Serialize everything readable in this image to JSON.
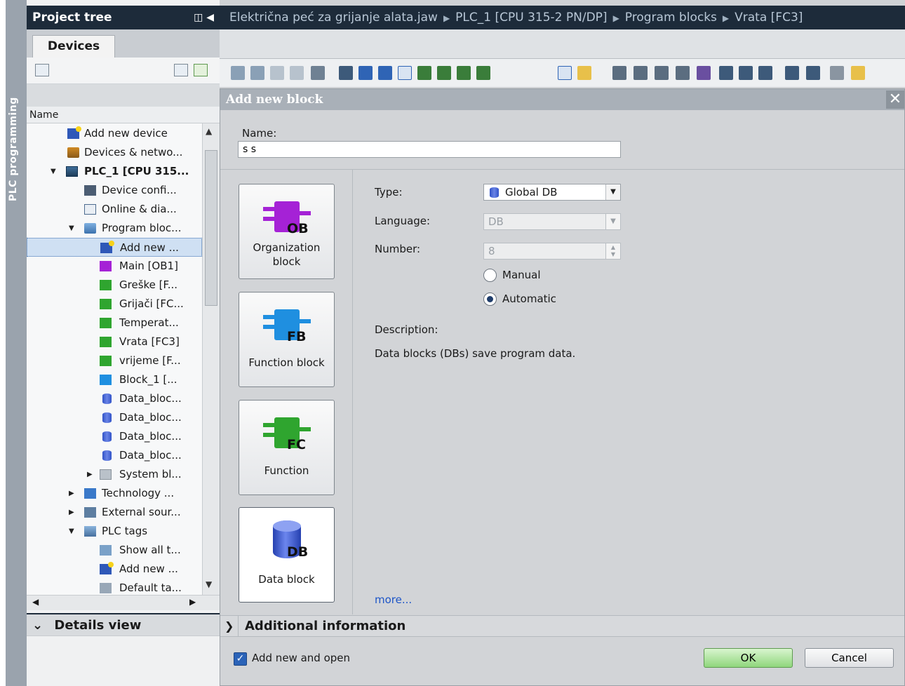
{
  "sidebar_strip": {
    "label": "PLC programming"
  },
  "project_tree": {
    "title": "Project tree",
    "tab": "Devices",
    "column_header": "Name",
    "items": [
      {
        "label": "Add new device",
        "icon": "add-device-icon",
        "level": 1
      },
      {
        "label": "Devices & netwo...",
        "icon": "network-icon",
        "level": 1
      },
      {
        "label": "PLC_1 [CPU 315...",
        "icon": "plc-icon",
        "level": 1,
        "expanded": true
      },
      {
        "label": "Device confi...",
        "icon": "device-config-icon",
        "level": 2
      },
      {
        "label": "Online & dia...",
        "icon": "online-diag-icon",
        "level": 2
      },
      {
        "label": "Program bloc...",
        "icon": "folder-icon",
        "level": 2,
        "expanded": true
      },
      {
        "label": "Add new ...",
        "icon": "add-block-icon",
        "level": 3,
        "selected": true
      },
      {
        "label": "Main [OB1]",
        "icon": "ob-icon",
        "level": 3
      },
      {
        "label": "Greške [F...",
        "icon": "fc-icon",
        "level": 3
      },
      {
        "label": "Grijači [FC...",
        "icon": "fc-icon",
        "level": 3
      },
      {
        "label": "Temperat...",
        "icon": "fc-icon",
        "level": 3
      },
      {
        "label": "Vrata [FC3]",
        "icon": "fc-icon",
        "level": 3
      },
      {
        "label": "vrijeme [F...",
        "icon": "fc-icon",
        "level": 3
      },
      {
        "label": "Block_1 [...",
        "icon": "fb-icon",
        "level": 3
      },
      {
        "label": "Data_bloc...",
        "icon": "db-icon",
        "level": 3
      },
      {
        "label": "Data_bloc...",
        "icon": "db-icon",
        "level": 3
      },
      {
        "label": "Data_bloc...",
        "icon": "db-icon",
        "level": 3
      },
      {
        "label": "Data_bloc...",
        "icon": "db-icon",
        "level": 3
      },
      {
        "label": "System bl...",
        "icon": "system-blocks-icon",
        "level": 3,
        "collapsed": true
      },
      {
        "label": "Technology ...",
        "icon": "technology-icon",
        "level": 2,
        "collapsed": true
      },
      {
        "label": "External sour...",
        "icon": "external-source-icon",
        "level": 2,
        "collapsed": true
      },
      {
        "label": "PLC tags",
        "icon": "plc-tags-icon",
        "level": 2,
        "expanded": true
      },
      {
        "label": "Show all t...",
        "icon": "show-tags-icon",
        "level": 3
      },
      {
        "label": "Add new ...",
        "icon": "add-tag-table-icon",
        "level": 3
      },
      {
        "label": "Default ta...",
        "icon": "default-table-icon",
        "level": 3
      }
    ],
    "details_view": "Details view"
  },
  "breadcrumb": {
    "parts": [
      "Električna peć za grijanje alata.jaw",
      "PLC_1 [CPU 315-2 PN/DP]",
      "Program blocks",
      "Vrata [FC3]"
    ]
  },
  "dialog": {
    "title": "Add new block",
    "name_label": "Name:",
    "name_value": "s s",
    "blocks": [
      {
        "label": "Organization block",
        "tag": "OB",
        "color": "#a522d6"
      },
      {
        "label": "Function block",
        "tag": "FB",
        "color": "#1f8fe0"
      },
      {
        "label": "Function",
        "tag": "FC",
        "color": "#2fa52f"
      },
      {
        "label": "Data block",
        "tag": "DB",
        "color": "#3153c8",
        "active": true
      }
    ],
    "type_label": "Type:",
    "type_value": "Global DB",
    "language_label": "Language:",
    "language_value": "DB",
    "number_label": "Number:",
    "number_value": "8",
    "radio_manual": "Manual",
    "radio_automatic": "Automatic",
    "radio_selected": "Automatic",
    "description_label": "Description:",
    "description_text": "Data blocks (DBs) save program data.",
    "more_link": "more...",
    "additional_info": "Additional  information",
    "add_new_and_open": "Add new and open",
    "ok_label": "OK",
    "cancel_label": "Cancel"
  }
}
